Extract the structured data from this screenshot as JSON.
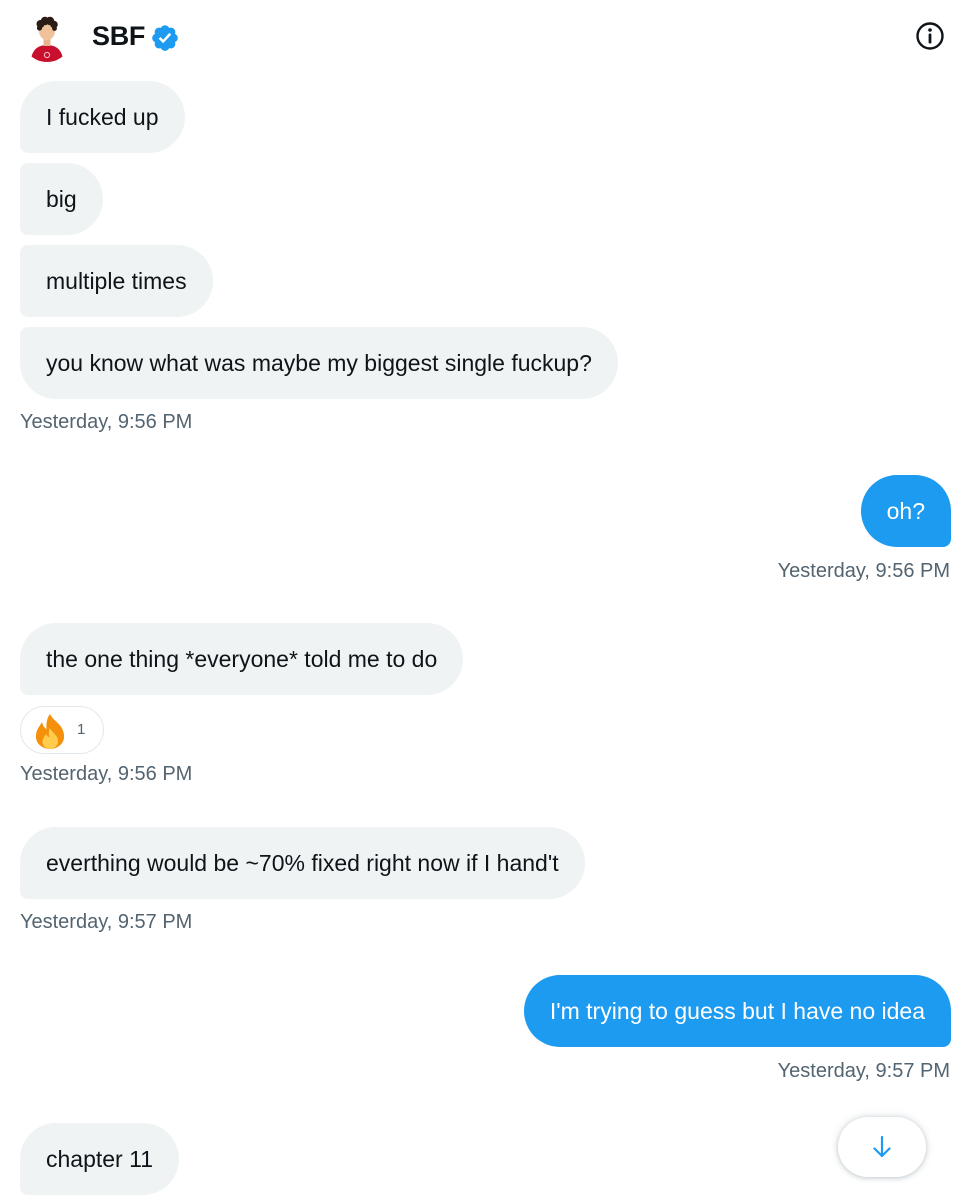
{
  "header": {
    "name": "SBF",
    "avatar_icon": "profile-avatar",
    "verified_icon": "verified-badge-icon",
    "info_icon": "info-icon",
    "accent_color": "#1d9bf0"
  },
  "messages": [
    {
      "direction": "received",
      "text": "I fucked up"
    },
    {
      "direction": "received",
      "text": "big"
    },
    {
      "direction": "received",
      "text": "multiple times"
    },
    {
      "direction": "received",
      "text": "you know what was maybe my biggest single fuckup?",
      "timestamp": "Yesterday, 9:56 PM"
    },
    {
      "direction": "sent",
      "text": "oh?",
      "timestamp": "Yesterday, 9:56 PM"
    },
    {
      "direction": "received",
      "text": "the one thing *everyone* told me to do",
      "reaction": {
        "icon": "fire-emoji",
        "count": "1"
      },
      "timestamp": "Yesterday, 9:56 PM"
    },
    {
      "direction": "received",
      "text": "everthing would be ~70% fixed right now if I hand't",
      "timestamp": "Yesterday, 9:57 PM"
    },
    {
      "direction": "sent",
      "text": "I'm trying to guess but I have no idea",
      "timestamp": "Yesterday, 9:57 PM"
    },
    {
      "direction": "received",
      "text": "chapter 11"
    }
  ],
  "scroll_down_icon": "arrow-down-icon"
}
